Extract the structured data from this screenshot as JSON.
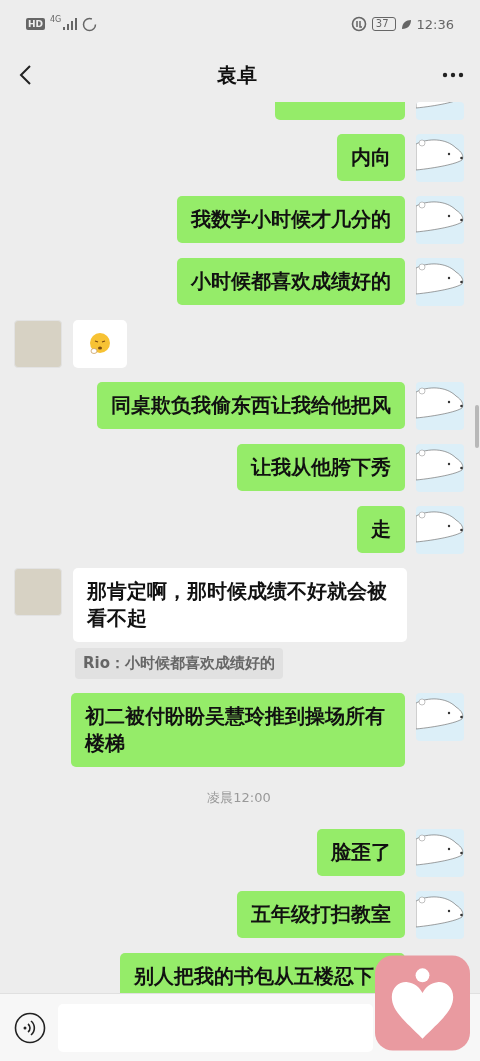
{
  "status_bar": {
    "network_badge": "HD",
    "network_type": "4G",
    "battery": "37",
    "time": "12:36"
  },
  "header": {
    "title": "袁卓"
  },
  "messages": [
    {
      "kind": "sent_cut"
    },
    {
      "kind": "sent",
      "text": "内向"
    },
    {
      "kind": "sent",
      "text": "我数学小时候才几分的"
    },
    {
      "kind": "sent",
      "text": "小时候都喜欢成绩好的"
    },
    {
      "kind": "received_emoji"
    },
    {
      "kind": "sent",
      "text": "同桌欺负我偷东西让我给他把风"
    },
    {
      "kind": "sent",
      "text": "让我从他胯下秀"
    },
    {
      "kind": "sent",
      "text": "走"
    },
    {
      "kind": "received",
      "text": "那肯定啊，那时候成绩不好就会被看不起"
    },
    {
      "kind": "quote",
      "text": "Rio：小时候都喜欢成绩好的"
    },
    {
      "kind": "sent",
      "text": "初二被付盼盼吴慧玲推到操场所有楼梯"
    },
    {
      "kind": "time",
      "text": "凌晨12:00"
    },
    {
      "kind": "sent",
      "text": "脸歪了"
    },
    {
      "kind": "sent",
      "text": "五年级打扫教室"
    },
    {
      "kind": "sent_covered",
      "text": "别人把我的书包从五楼忍下"
    }
  ]
}
